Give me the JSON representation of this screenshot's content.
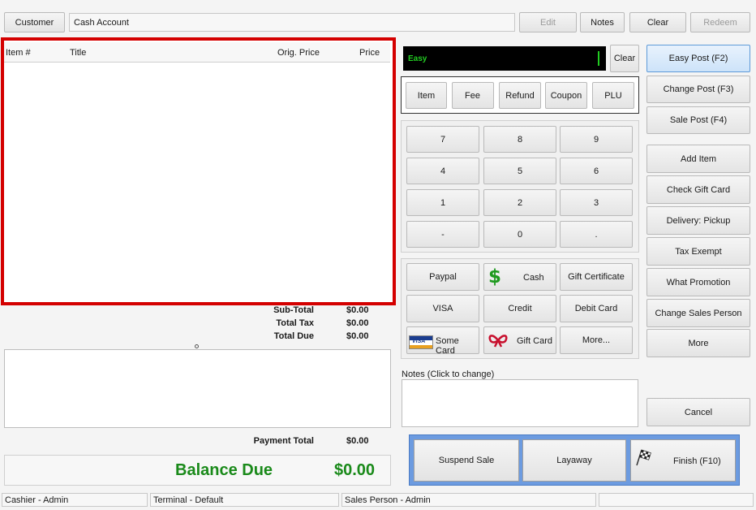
{
  "top": {
    "customer_label": "Customer",
    "account_value": "Cash Account",
    "edit_label": "Edit",
    "notes_label": "Notes",
    "clear_label": "Clear",
    "redeem_label": "Redeem"
  },
  "items_list": {
    "columns": [
      "Item #",
      "Title",
      "Orig. Price",
      "Price"
    ]
  },
  "totals": {
    "subtotal_label": "Sub-Total",
    "subtotal_value": "$0.00",
    "tax_label": "Total Tax",
    "tax_value": "$0.00",
    "due_label": "Total Due",
    "due_value": "$0.00",
    "payment_total_label": "Payment Total",
    "payment_total_value": "$0.00",
    "balance_label": "Balance Due",
    "balance_value": "$0.00"
  },
  "entry": {
    "display_text": "Easy",
    "clear_label": "Clear"
  },
  "mode_buttons": [
    "Item",
    "Fee",
    "Refund",
    "Coupon",
    "PLU"
  ],
  "keypad": [
    "7",
    "8",
    "9",
    "4",
    "5",
    "6",
    "1",
    "2",
    "3",
    "-",
    "0",
    "."
  ],
  "payments": {
    "paypal": "Paypal",
    "cash": "Cash",
    "gift_certificate": "Gift Certificate",
    "visa": "VISA",
    "credit": "Credit",
    "debit_card": "Debit Card",
    "some_card": "Some Card",
    "gift_card": "Gift Card",
    "more": "More..."
  },
  "notes": {
    "label": "Notes (Click to change)"
  },
  "right_panel": {
    "easy_post": "Easy Post (F2)",
    "change_post": "Change Post (F3)",
    "sale_post": "Sale Post (F4)",
    "add_item": "Add Item",
    "check_gift_card": "Check Gift Card",
    "delivery": "Delivery: Pickup",
    "tax_exempt": "Tax Exempt",
    "what_promotion": "What Promotion",
    "change_sales_person": "Change Sales Person",
    "more": "More",
    "cancel": "Cancel"
  },
  "finish_bar": {
    "suspend": "Suspend Sale",
    "layaway": "Layaway",
    "finish": "Finish (F10)"
  },
  "status_bar": {
    "cashier": "Cashier - Admin",
    "terminal": "Terminal - Default",
    "sales_person": "Sales Person - Admin",
    "extra": ""
  },
  "colors": {
    "highlight_border": "#d40000",
    "balance_green": "#1a8a1a",
    "display_bg": "#000000",
    "display_text": "#22cc22",
    "finish_panel": "#6c9be0"
  }
}
